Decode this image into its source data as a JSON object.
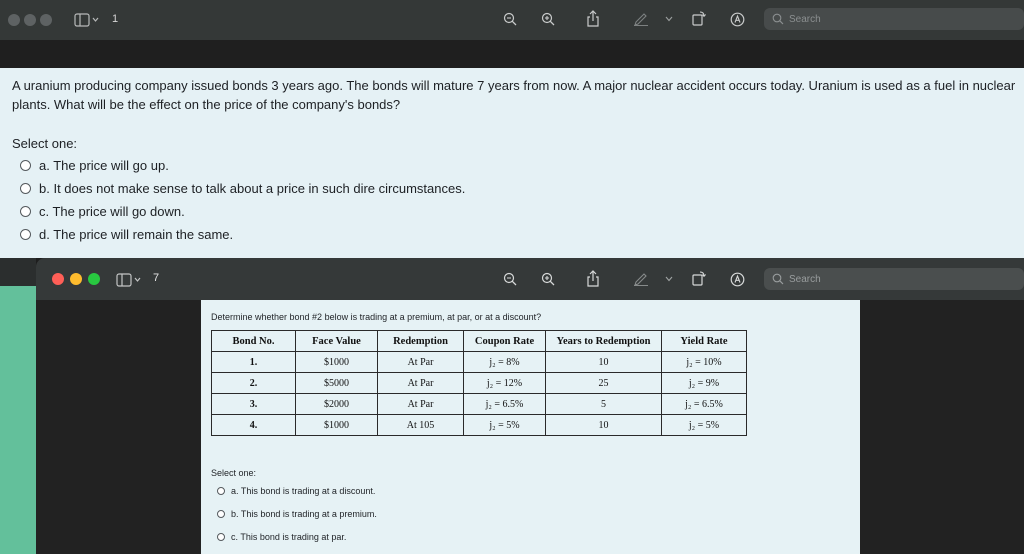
{
  "back_window": {
    "page_number": "1",
    "search_placeholder": "Search",
    "question": "A uranium producing company issued bonds 3 years ago. The bonds will mature 7 years from now. A major nuclear accident occurs today. Uranium is used as a fuel in nuclear plants. What will be the effect on the price of the company's bonds?",
    "select_label": "Select one:",
    "options": [
      "a. The price will go up.",
      "b. It does not make sense to talk about a price in such dire circumstances.",
      "c. The price will go down.",
      "d. The price will remain the same."
    ]
  },
  "front_window": {
    "page_number": "7",
    "search_placeholder": "Search",
    "traffic_light_colors": [
      "#ff5f57",
      "#febc2e",
      "#28c840"
    ],
    "prompt": "Determine whether bond #2 below is trading at a premium, at par, or at a discount?",
    "table": {
      "headers": [
        "Bond No.",
        "Face Value",
        "Redemption",
        "Coupon Rate",
        "Years to Redemption",
        "Yield Rate"
      ],
      "rows": [
        [
          "1.",
          "$1000",
          "At Par",
          "j₂ = 8%",
          "10",
          "j₂ = 10%"
        ],
        [
          "2.",
          "$5000",
          "At Par",
          "j₂ = 12%",
          "25",
          "j₂ = 9%"
        ],
        [
          "3.",
          "$2000",
          "At Par",
          "j₂ = 6.5%",
          "5",
          "j₂ = 6.5%"
        ],
        [
          "4.",
          "$1000",
          "At 105",
          "j₂ = 5%",
          "10",
          "j₂ = 5%"
        ]
      ]
    },
    "select_label": "Select one:",
    "options": [
      "a. This bond is trading at a discount.",
      "b. This bond is trading at a premium.",
      "c. This bond is trading at par."
    ]
  }
}
